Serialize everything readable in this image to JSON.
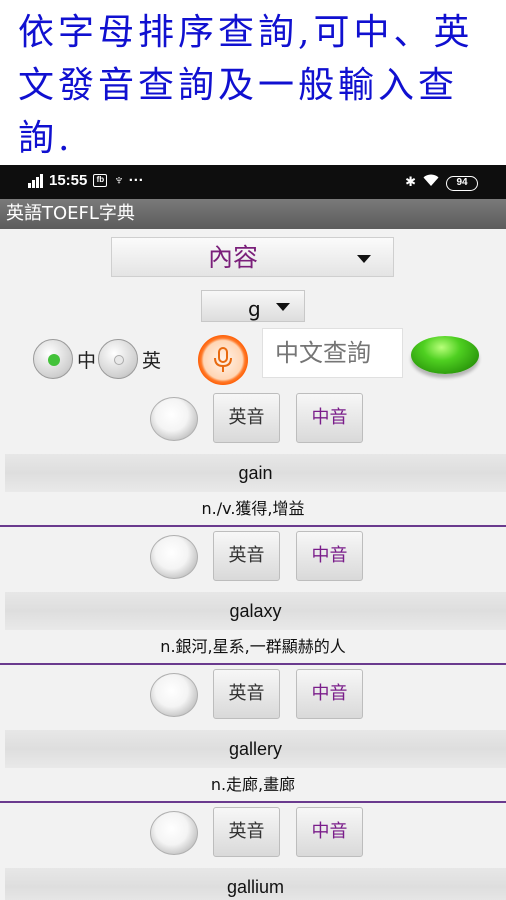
{
  "promo": {
    "caption": "依字母排序查詢,可中、英文發音查詢及一般輸入查詢."
  },
  "status_bar": {
    "time": "15:55",
    "extra": "♆ ···",
    "battery": "94"
  },
  "app": {
    "title": "英語TOEFL字典"
  },
  "controls": {
    "content_dropdown": "內容",
    "letter_dropdown": "g",
    "radio_chinese": "中",
    "radio_english": "英",
    "selected_language": "中",
    "search_placeholder": "中文查詢",
    "colors": {
      "accent_purple": "#7a1d8a",
      "go_green": "#3cb816",
      "mic_orange": "#ff5a00"
    }
  },
  "entries": [
    {
      "word": "gain",
      "meaning": "n./v.獲得,增益",
      "en_btn": "英音",
      "zh_btn": "中音"
    },
    {
      "word": "galaxy",
      "meaning": "n.銀河,星系,一群顯赫的人",
      "en_btn": "英音",
      "zh_btn": "中音"
    },
    {
      "word": "gallery",
      "meaning": "n.走廊,畫廊",
      "en_btn": "英音",
      "zh_btn": "中音"
    },
    {
      "word": "gallium",
      "meaning": "",
      "en_btn": "英音",
      "zh_btn": "中音"
    }
  ]
}
